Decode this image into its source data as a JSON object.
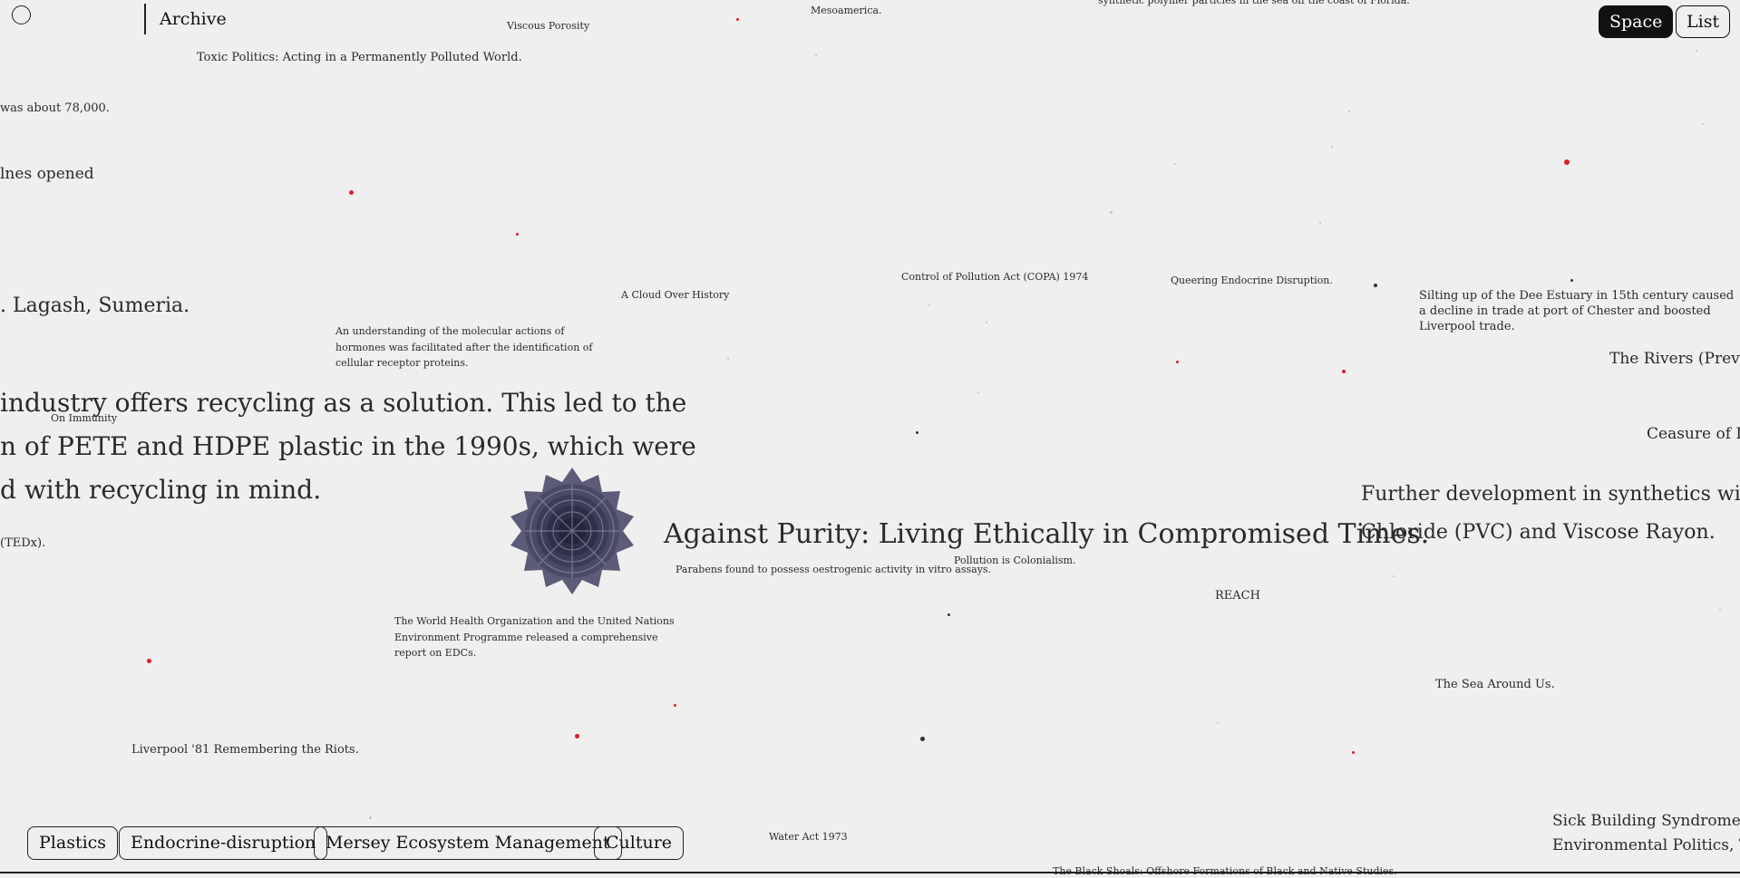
{
  "header": {
    "archive_label": "Archive",
    "view_toggle": {
      "space_label": "Space",
      "list_label": "List",
      "active": "Space"
    }
  },
  "filter_tags": [
    "Plastics",
    "Endocrine-disruption",
    "Mersey Ecosystem Management",
    "Culture"
  ],
  "archive_entries": {
    "viscous_porosity": "Viscous Porosity",
    "mesoamerica": "Mesoamerica.",
    "synthetic_polymer": "synthetic polymer particles in the sea off the coast of Florida.",
    "toxic_politics": "Toxic Politics: Acting in a Permanently Polluted World.",
    "was_about": "was about 78,000.",
    "lines_opened": "lnes opened",
    "lagash": ". Lagash, Sumeria.",
    "cloud_over_history": "A Cloud Over History",
    "copa": "Control of Pollution Act (COPA) 1974",
    "queering": "Queering Endocrine Disruption.",
    "dee_estuary": "Silting up of the Dee Estuary in 15th century caused a decline in trade at port of Chester and boosted Liverpool trade.",
    "hormones": "An understanding of the molecular actions of hormones was facilitated after the identification of cellular receptor proteins.",
    "rivers": "The Rivers (Preventic",
    "recycling_1": "industry offers recycling as a solution. This led to the",
    "recycling_2": "n of PETE and HDPE plastic in the 1990s, which were",
    "recycling_3": "d with recycling in mind.",
    "on_immunity": "On Immunity",
    "ceasure": "Ceasure of L",
    "synthetics_1": "Further development in synthetics wit",
    "synthetics_2": "Chloride (PVC) and Viscose Rayon.",
    "tedx": "(TEDx).",
    "against_purity": "Against Purity: Living Ethically in Compromised Times.",
    "parabens": "Parabens found to possess oestrogenic activity in vitro assays.",
    "pollution_colonialism": "Pollution is Colonialism.",
    "reach": "REACH",
    "who_unep": "The World Health Organization and the United Nations Environment Programme released a comprehensive report on EDCs.",
    "sea_around_us": "The Sea Around Us.",
    "liverpool81": "Liverpool '81 Remembering the Riots.",
    "water_act": "Water Act 1973",
    "sick_building_1": "Sick Building Syndrome and",
    "sick_building_2": "Environmental Politics, Techi",
    "black_shoals": "The Black Shoals: Offshore Formations of Black and Native Studies."
  },
  "icons": {
    "menu": "circle-menu-icon",
    "featured_image": "pinecone-image"
  },
  "colors": {
    "background": "#efefef",
    "accent_dot": "#d81e2a",
    "text": "#222222",
    "active_button": "#111111"
  }
}
